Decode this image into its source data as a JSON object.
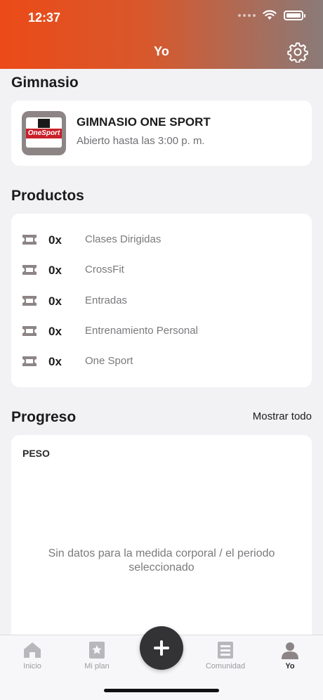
{
  "status_bar": {
    "time": "12:37"
  },
  "header": {
    "title": "Yo",
    "settings_icon": "gear-icon"
  },
  "gym_section": {
    "title": "Gimnasio",
    "gym": {
      "logo_text": "OneSport",
      "name": "GIMNASIO ONE SPORT",
      "hours": "Abierto hasta las 3:00 p. m."
    }
  },
  "products_section": {
    "title": "Productos",
    "items": [
      {
        "qty": "0x",
        "name": "Clases Dirigidas",
        "icon": "ticket-icon"
      },
      {
        "qty": "0x",
        "name": "CrossFit",
        "icon": "ticket-icon"
      },
      {
        "qty": "0x",
        "name": "Entradas",
        "icon": "ticket-icon"
      },
      {
        "qty": "0x",
        "name": "Entrenamiento Personal",
        "icon": "ticket-icon"
      },
      {
        "qty": "0x",
        "name": "One Sport",
        "icon": "ticket-icon"
      }
    ]
  },
  "progress_section": {
    "title": "Progreso",
    "show_all": "Mostrar todo",
    "metric_label": "PESO",
    "empty_message": "Sin datos para la medida corporal / el periodo seleccionado"
  },
  "tabbar": {
    "tabs": [
      {
        "label": "Inicio",
        "icon": "home-icon"
      },
      {
        "label": "Mi plan",
        "icon": "star-icon"
      },
      {
        "label": "Comunidad",
        "icon": "community-icon"
      },
      {
        "label": "Yo",
        "icon": "profile-icon",
        "active": true
      }
    ],
    "fab_icon": "plus-icon"
  },
  "colors": {
    "header_start": "#ec4a18",
    "header_end": "#8a7a78",
    "background": "#f2f2f5",
    "icon_gray": "#8d8585"
  }
}
